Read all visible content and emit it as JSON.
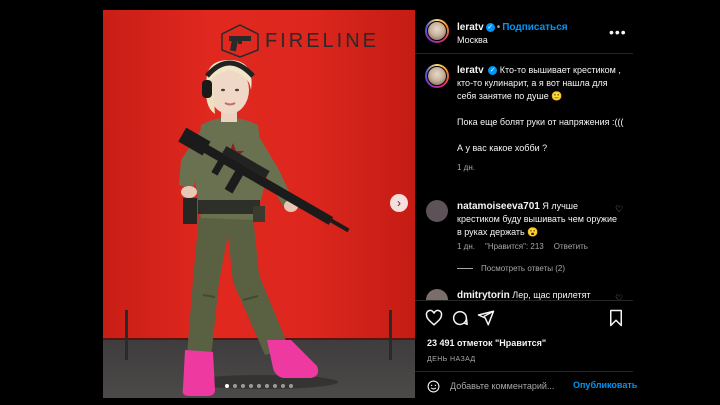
{
  "photo": {
    "watermark": "FIRELINE",
    "next_icon": "chevron-right-icon",
    "carousel": {
      "count": 9,
      "active_index": 0
    }
  },
  "header": {
    "username": "leratv",
    "separator": "•",
    "follow_label": "Подписаться",
    "location": "Москва",
    "more_icon": "more-icon"
  },
  "caption": {
    "username": "leratv",
    "lines": [
      "Кто-то вышивает крестиком , кто-то кулинарит, а я вот нашла для себя занятие по душе 🙂",
      "Пока еще болят руки от напряжения :(((",
      "А у вас какое хобби ?"
    ],
    "age": "1 дн."
  },
  "comments": [
    {
      "username": "natamoiseeva701",
      "text": "Я лучше крестиком буду вышивать чем оружие в руках держать 😮",
      "age": "1 дн.",
      "likes": "\"Нравится\": 213",
      "reply": "Ответить",
      "view_replies": "Посмотреть ответы (2)"
    },
    {
      "username": "dmitrytorin",
      "text": "Лер, щас прилетят"
    }
  ],
  "actions": {
    "likes": "23 491 отметок \"Нравится\"",
    "date": "ДЕНЬ НАЗАД",
    "comment_placeholder": "Добавьте комментарий...",
    "publish_label": "Опубликовать"
  }
}
